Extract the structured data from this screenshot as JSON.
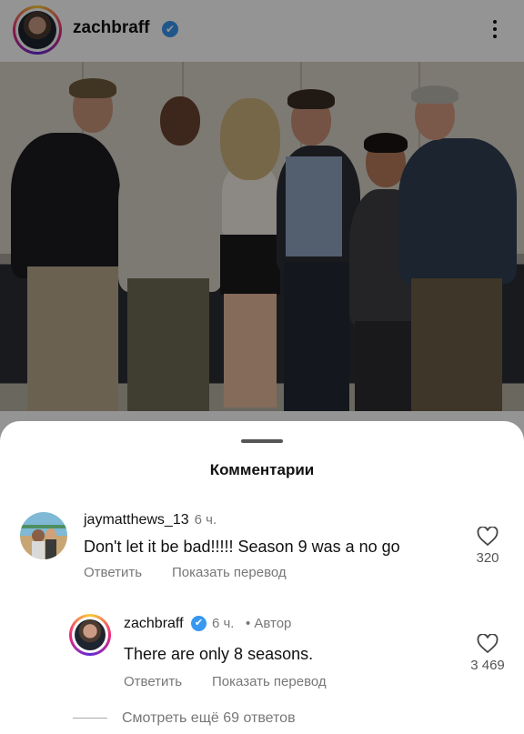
{
  "post": {
    "username": "zachbraff",
    "verified_glyph": "✔",
    "more_icon": "more-vertical-icon"
  },
  "sheet": {
    "title": "Комментарии"
  },
  "comments": [
    {
      "username": "jaymatthews_13",
      "time": "6 ч.",
      "text": "Don't let it be bad!!!!! Season 9 was a no go",
      "reply_label": "Ответить",
      "translate_label": "Показать перевод",
      "likes": "320"
    }
  ],
  "reply": {
    "username": "zachbraff",
    "time": "6 ч.",
    "author_tag": "• Автор",
    "text": "There are only 8 seasons.",
    "reply_label": "Ответить",
    "translate_label": "Показать перевод",
    "likes": "3 469"
  },
  "more_replies": "Смотреть ещё 69 ответов",
  "colors": {
    "verified": "#3897f0",
    "secondary_text": "#777777"
  }
}
